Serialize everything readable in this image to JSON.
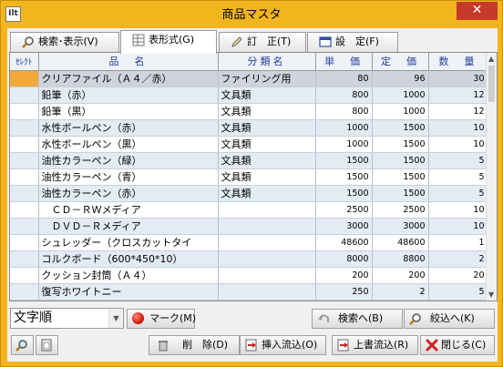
{
  "window": {
    "title": "商品マスタ",
    "close_glyph": "✕",
    "app_icon": "Ilt"
  },
  "tabs": [
    {
      "label": "検索･表示(V)",
      "icon": "magnifier-icon"
    },
    {
      "label": "表形式(G)",
      "icon": "table-icon"
    },
    {
      "label": "訂　正(T)",
      "icon": "pencil-icon"
    },
    {
      "label": "設　定(F)",
      "icon": "window-icon"
    }
  ],
  "grid": {
    "columns": [
      "ｾﾚｸﾄ",
      "品　名",
      "分類名",
      "単　価",
      "定　価",
      "数　量"
    ],
    "rows": [
      {
        "name": "クリアファイル（Ａ４／赤）",
        "category": "ファイリング用",
        "unit_price": "80",
        "list_price": "96",
        "qty": "30"
      },
      {
        "name": "鉛筆（赤）",
        "category": "文具類",
        "unit_price": "800",
        "list_price": "1000",
        "qty": "12"
      },
      {
        "name": "鉛筆（黒）",
        "category": "文具類",
        "unit_price": "800",
        "list_price": "1000",
        "qty": "12"
      },
      {
        "name": "水性ボールペン（赤）",
        "category": "文具類",
        "unit_price": "1000",
        "list_price": "1500",
        "qty": "10"
      },
      {
        "name": "水性ボールペン（黒）",
        "category": "文具類",
        "unit_price": "1000",
        "list_price": "1500",
        "qty": "10"
      },
      {
        "name": "油性カラーペン（緑）",
        "category": "文具類",
        "unit_price": "1500",
        "list_price": "1500",
        "qty": "5"
      },
      {
        "name": "油性カラーペン（青）",
        "category": "文具類",
        "unit_price": "1500",
        "list_price": "1500",
        "qty": "5"
      },
      {
        "name": "油性カラーペン（赤）",
        "category": "文具類",
        "unit_price": "1500",
        "list_price": "1500",
        "qty": "5"
      },
      {
        "name": "　ＣＤ－ＲＷメディア",
        "category": "",
        "unit_price": "2500",
        "list_price": "2500",
        "qty": "10"
      },
      {
        "name": "　ＤＶＤ－Ｒメディア",
        "category": "",
        "unit_price": "3000",
        "list_price": "3000",
        "qty": "10"
      },
      {
        "name": "シュレッダー（クロスカットタイ",
        "category": "",
        "unit_price": "48600",
        "list_price": "48600",
        "qty": "1"
      },
      {
        "name": "コルクボード（600*450*10）",
        "category": "",
        "unit_price": "8000",
        "list_price": "8800",
        "qty": "2"
      },
      {
        "name": "クッション封筒（Ａ４）",
        "category": "",
        "unit_price": "200",
        "list_price": "200",
        "qty": "20"
      },
      {
        "name": "復写ホワイトニー",
        "category": "",
        "unit_price": "250",
        "list_price": "2",
        "qty": "5"
      }
    ]
  },
  "sort_combo": {
    "value": "文字順"
  },
  "buttons": {
    "mark": "マーク(M)",
    "search_next": "検索へ(B)",
    "filter": "絞込へ(K)",
    "delete": "削　除(D)",
    "insert": "挿入流込(O)",
    "overwrite": "上書流込(R)",
    "close": "閉じる(C)"
  }
}
